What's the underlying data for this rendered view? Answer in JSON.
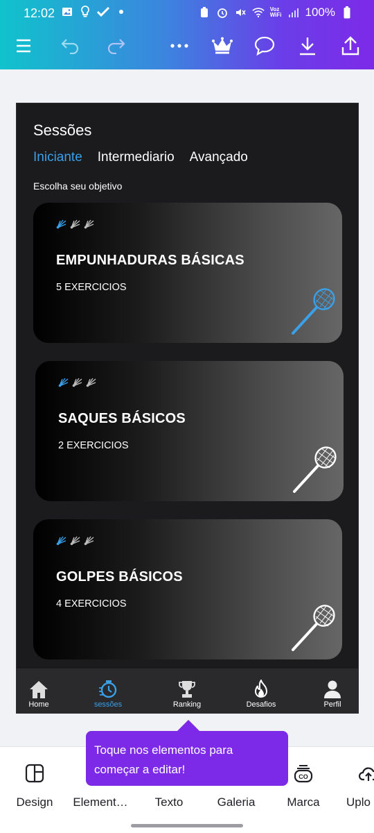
{
  "status_bar": {
    "time": "12:02",
    "network_label_top": "Voz",
    "network_label_bottom": "WiFi",
    "battery": "100%"
  },
  "toolbar": {
    "icons": [
      "menu-icon",
      "undo-icon",
      "redo-icon",
      "more-icon",
      "crown-icon",
      "comment-icon",
      "download-icon",
      "share-icon"
    ]
  },
  "design": {
    "title": "Sessões",
    "tabs": [
      {
        "label": "Iniciante",
        "active": true
      },
      {
        "label": "Intermediario",
        "active": false
      },
      {
        "label": "Avançado",
        "active": false
      }
    ],
    "subtitle": "Escolha seu objetivo",
    "cards": [
      {
        "title": "EMPUNHADURAS BÁSICAS",
        "count": "5 EXERCICIOS",
        "racket_color": "#3aa0e8"
      },
      {
        "title": "SAQUES BÁSICOS",
        "count": "2 EXERCICIOS",
        "racket_color": "#ffffff"
      },
      {
        "title": "GOLPES BÁSICOS",
        "count": "4 EXERCICIOS",
        "racket_color": "#ffffff"
      }
    ],
    "nav": [
      {
        "label": "Home",
        "icon": "home-icon",
        "active": false
      },
      {
        "label": "sessões",
        "icon": "timer-icon",
        "active": true
      },
      {
        "label": "Ranking",
        "icon": "trophy-icon",
        "active": false
      },
      {
        "label": "Desafios",
        "icon": "fire-icon",
        "active": false
      },
      {
        "label": "Perfil",
        "icon": "person-icon",
        "active": false
      }
    ]
  },
  "tooltip": {
    "text": "Toque nos elementos para começar a editar!"
  },
  "tray": {
    "items": [
      {
        "label": "Design",
        "icon": "layout-icon"
      },
      {
        "label": "Element…",
        "icon": "elements-icon"
      },
      {
        "label": "Texto",
        "icon": "text-icon"
      },
      {
        "label": "Galeria",
        "icon": "gallery-icon"
      },
      {
        "label": "Marca",
        "icon": "brand-icon"
      },
      {
        "label": "Uplo",
        "icon": "upload-icon"
      }
    ]
  },
  "colors": {
    "accent": "#3aa0e8",
    "tooltip": "#7d2ae8"
  }
}
